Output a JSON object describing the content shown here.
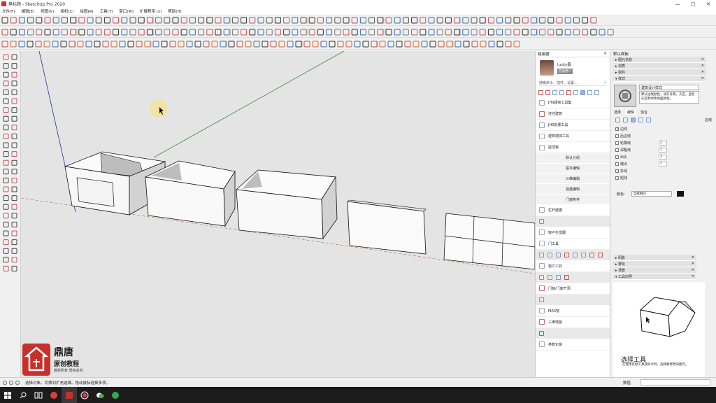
{
  "window": {
    "title": "無标题 - SketchUp Pro 2020",
    "controls": [
      "—",
      "□",
      "✕"
    ]
  },
  "menu": [
    "文件(F)",
    "编辑(E)",
    "视图(V)",
    "相机(C)",
    "绘图(R)",
    "工具(T)",
    "窗口(W)",
    "扩展程序 (x)",
    "帮助(H)"
  ],
  "plugin_panel": {
    "title": "链接器",
    "close": "✕",
    "user_name": "lucky鑫",
    "user_badge": "普通用户",
    "search_placeholder": "搜索命令、插件、设置...",
    "entries": [
      {
        "label": "JHS超级工具集",
        "icon": "jhs-icon"
      },
      {
        "label": "坯坯建筑",
        "icon": "building-icon"
      },
      {
        "label": "JHS批量工具",
        "icon": "jhs-icon"
      },
      {
        "label": "建筑墙体工具",
        "icon": "wall-icon"
      },
      {
        "label": "屋顶板",
        "icon": "roof-icon"
      }
    ],
    "sub_entries": [
      "默认分组",
      "基本编辑",
      "三维编辑",
      "自建编辑",
      "门窗构件"
    ],
    "entries2": [
      {
        "label": "栏杆建模",
        "icon": "railing-icon"
      },
      {
        "label": "窗户生成器",
        "icon": "window-icon"
      },
      {
        "label": "门工具",
        "icon": "door-icon"
      },
      {
        "label": "窗户工具",
        "icon": "window-tool-icon"
      },
      {
        "label": "门窗/门窗开洞",
        "icon": "opening-icon"
      },
      {
        "label": "MAX窗",
        "icon": "max-window-icon"
      },
      {
        "label": "三维墙窗",
        "icon": "3d-window-icon"
      },
      {
        "label": "参数化窗",
        "icon": "param-window-icon"
      }
    ]
  },
  "tray": {
    "title": "默认面板",
    "collapsed_sections": [
      "图元信息",
      "材质",
      "组件"
    ],
    "styles_section": "样式",
    "style_name": "建筑设计样式",
    "style_desc": "默认边线颜色，浅灰背景，天空，蓝色天空和绿色地面颜色。",
    "tabs": [
      "选择",
      "编辑",
      "混合"
    ],
    "active_tab": "编辑",
    "display_label": "边线",
    "edge_settings": [
      {
        "label": "边线",
        "checked": true,
        "value": ""
      },
      {
        "label": "后边线",
        "checked": false,
        "value": ""
      },
      {
        "label": "轮廓线",
        "checked": false,
        "value": "2"
      },
      {
        "label": "深粗线",
        "checked": false,
        "value": "1"
      },
      {
        "label": "出头",
        "checked": false,
        "value": "3"
      },
      {
        "label": "端点",
        "checked": false,
        "value": "7"
      },
      {
        "label": "抖动",
        "checked": false,
        "value": ""
      },
      {
        "label": "短线",
        "checked": false,
        "value": ""
      }
    ],
    "color_label": "颜色:",
    "color_value": "全部相同",
    "color_swatch": "#111111",
    "lower_sections": [
      "阴影",
      "雾化",
      "场景",
      "工具向导"
    ],
    "instructor_title": "选择工具",
    "instructor_desc": "在使用其他工具或命令时，选择要修改的图元。"
  },
  "watermark": {
    "title": "鼎唐",
    "subtitle": "原创教程",
    "note": "版权所有 侵权必究"
  },
  "status": {
    "message": "选择对象。切换到扩充选择。拖动鼠标选择多项。",
    "vcb_label": "数值",
    "vcb_value": ""
  },
  "colors": {
    "viewport_bg": "#e4e4e4",
    "accent_red": "#c8302c",
    "axis_green": "#3c8a3c",
    "axis_blue": "#2a2a9a"
  }
}
